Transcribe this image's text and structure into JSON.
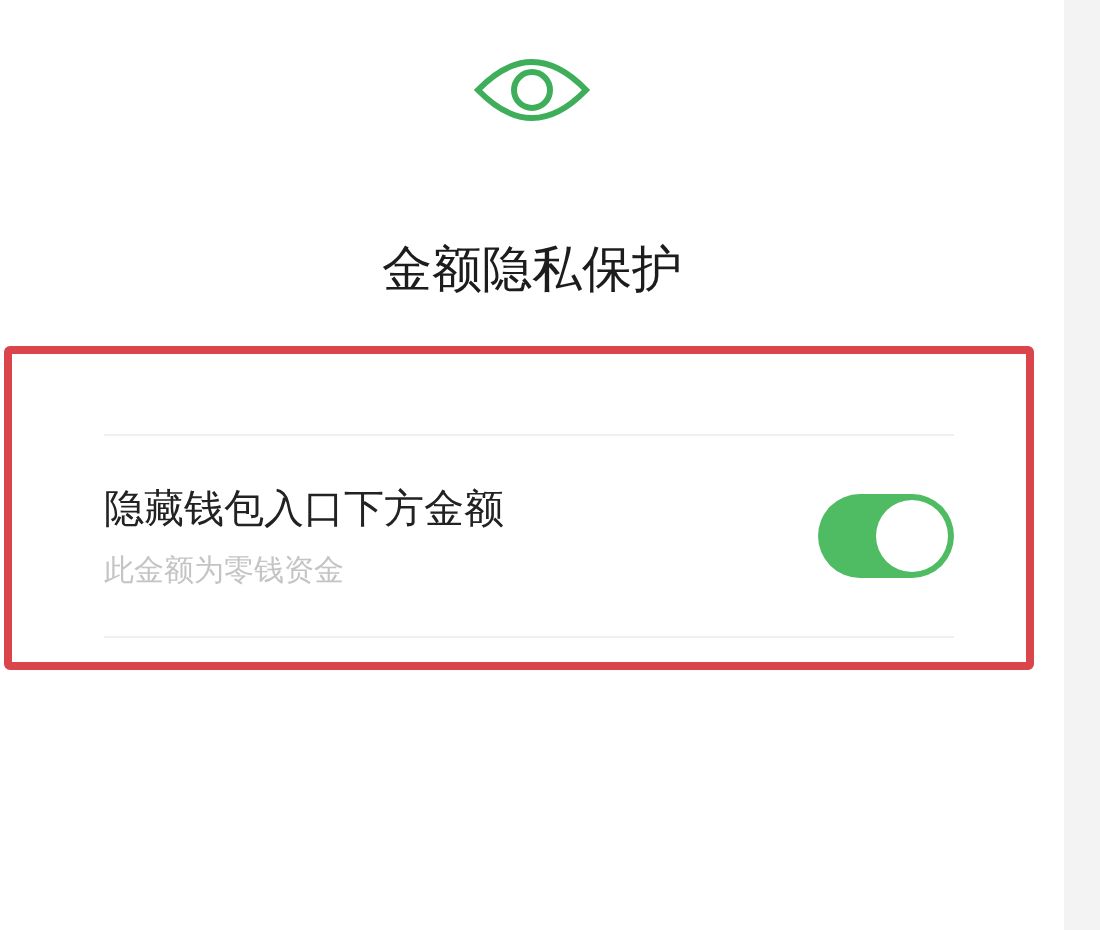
{
  "header": {
    "title": "金额隐私保护"
  },
  "settings": [
    {
      "kind": "toggle",
      "label": "隐藏钱包入口下方金额",
      "description": "此金额为零钱资金",
      "on": true
    }
  ],
  "highlight": {
    "color": "#d9454b"
  }
}
